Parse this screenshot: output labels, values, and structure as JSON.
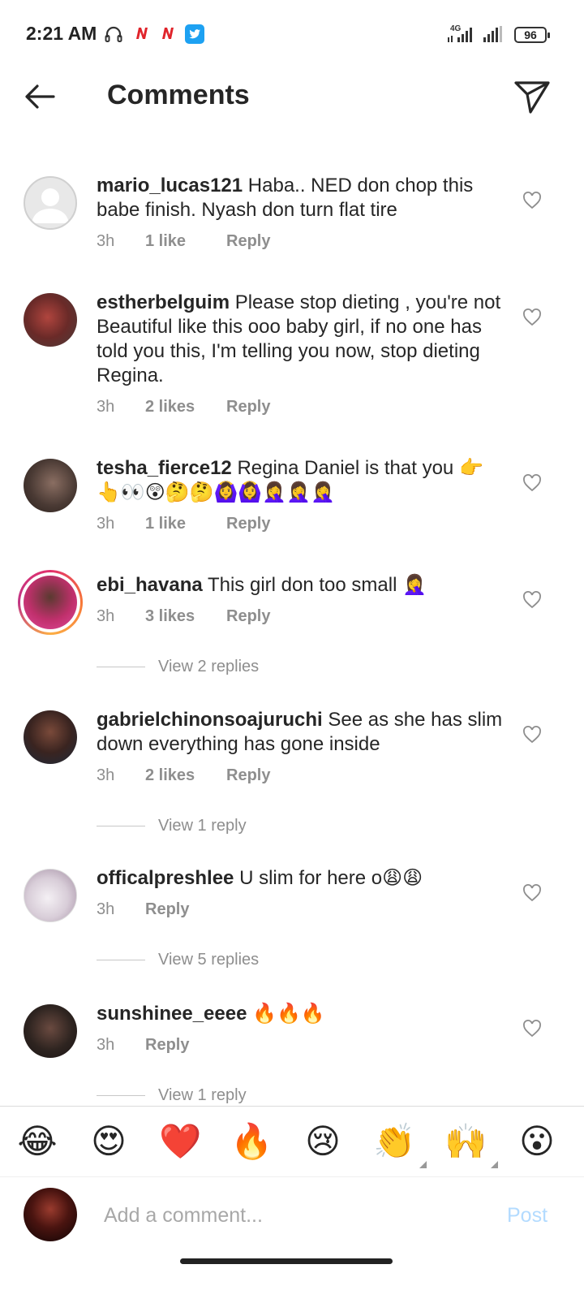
{
  "status_bar": {
    "time": "2:21 AM",
    "network": "4G",
    "battery": "96"
  },
  "header": {
    "title": "Comments"
  },
  "comments": [
    {
      "username": "mario_lucas121",
      "text": " Haba.. NED don chop this babe finish. Nyash don turn flat tire",
      "time": "3h",
      "likes": "1 like",
      "reply": "Reply",
      "avatar_color": "#dcdcdc"
    },
    {
      "username": "estherbelguim",
      "text": " Please stop dieting , you're not Beautiful like this ooo baby girl,  if no one has told you this, I'm telling you now, stop dieting Regina.",
      "time": "3h",
      "likes": "2 likes",
      "reply": "Reply",
      "avatar_color": "#7a3a38"
    },
    {
      "username": "tesha_fierce12",
      "text": " Regina Daniel is that you 👉👆👀😲🤔🤔🙆‍♀️🙆‍♀️🤦‍♀️🤦‍♀️🤦‍♀️",
      "time": "3h",
      "likes": "1 like",
      "reply": "Reply",
      "avatar_color": "#5a4a44"
    },
    {
      "username": "ebi_havana",
      "text": " This girl don too small 🤦‍♀️",
      "time": "3h",
      "likes": "3 likes",
      "reply": "Reply",
      "avatar_color": "#d0407a",
      "view_replies": "View 2 replies"
    },
    {
      "username": "gabrielchinonsoajuruchi",
      "text": " See as she has slim down everything has gone inside",
      "time": "3h",
      "likes": "2 likes",
      "reply": "Reply",
      "avatar_color": "#3a2a28",
      "view_replies": "View 1 reply"
    },
    {
      "username": "officalpreshlee",
      "text": " U slim for here o😩😩",
      "time": "3h",
      "likes": "",
      "reply": "Reply",
      "avatar_color": "#c9c3cc",
      "view_replies": "View 5 replies"
    },
    {
      "username": "sunshinee_eeee",
      "text": " 🔥🔥🔥",
      "time": "3h",
      "likes": "",
      "reply": "Reply",
      "avatar_color": "#2f2624",
      "view_replies": "View 1 reply"
    }
  ],
  "emoji_bar": [
    "😂",
    "😍",
    "❤️",
    "🔥",
    "😢",
    "👏",
    "🙌",
    "😮"
  ],
  "input": {
    "placeholder": "Add a comment...",
    "post_label": "Post"
  },
  "colors": {
    "accent": "#0095f6",
    "post_disabled": "#b3dbff",
    "muted": "#8e8e8e"
  }
}
